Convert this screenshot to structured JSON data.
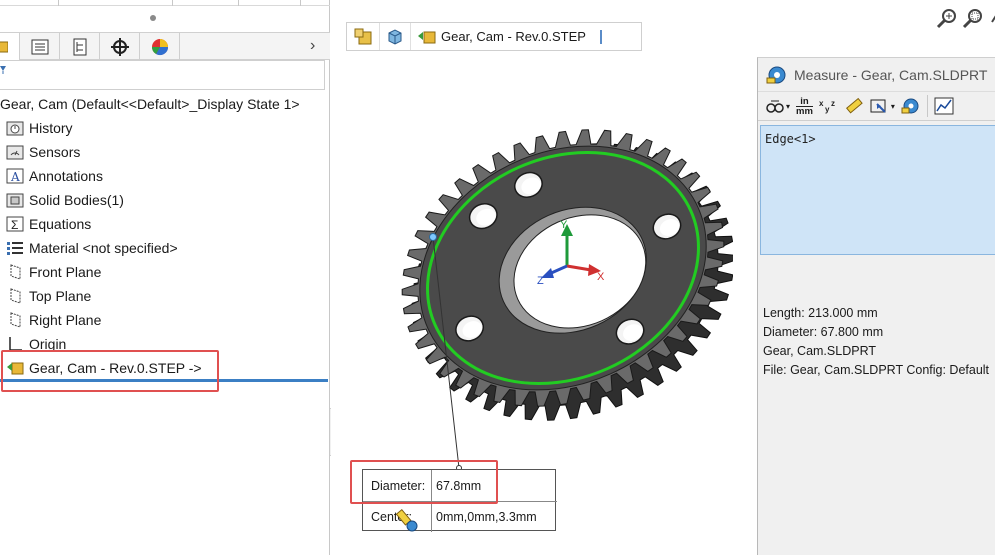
{
  "feature_manager": {
    "tabs": [
      "featuremanager-tab",
      "propertymanager-tab",
      "configurationmanager-tab",
      "dimxpert-tab",
      "display-manager-tab"
    ],
    "root_label": "Gear, Cam  (Default<<Default>_Display State 1>",
    "items": [
      {
        "label": "History",
        "icon": "history-folder-icon"
      },
      {
        "label": "Sensors",
        "icon": "sensors-folder-icon"
      },
      {
        "label": "Annotations",
        "icon": "annotations-icon"
      },
      {
        "label": "Solid Bodies(1)",
        "icon": "solid-bodies-icon"
      },
      {
        "label": "Equations",
        "icon": "equations-icon"
      },
      {
        "label": "Material <not specified>",
        "icon": "material-icon"
      },
      {
        "label": "Front Plane",
        "icon": "plane-icon"
      },
      {
        "label": "Top Plane",
        "icon": "plane-icon"
      },
      {
        "label": "Right Plane",
        "icon": "plane-icon"
      },
      {
        "label": "Origin",
        "icon": "origin-icon"
      },
      {
        "label": "Gear, Cam - Rev.0.STEP ->",
        "icon": "imported-feature-icon"
      }
    ]
  },
  "breadcrumb": {
    "label": "Gear, Cam - Rev.0.STEP"
  },
  "triad": {
    "x": "X",
    "y": "Y",
    "z": "Z"
  },
  "callout": {
    "diameter_label": "Diameter:",
    "diameter_value": "67.8mm",
    "center_label": "Center:",
    "center_value": "0mm,0mm,3.3mm"
  },
  "measure_dialog": {
    "title": "Measure - Gear, Cam.SLDPRT",
    "units_label_top": "in",
    "units_label_bottom": "mm",
    "selection": "Edge<1>",
    "results": [
      "Length: 213.000 mm",
      "Diameter: 67.800 mm",
      "Gear, Cam.SLDPRT",
      "File: Gear, Cam.SLDPRT Config: Default"
    ]
  },
  "colors": {
    "highlight_box": "#e05050",
    "selected_edge": "#22cc22",
    "selection_bg": "#cfe4f7",
    "gear_body": "#4a4a4a"
  }
}
